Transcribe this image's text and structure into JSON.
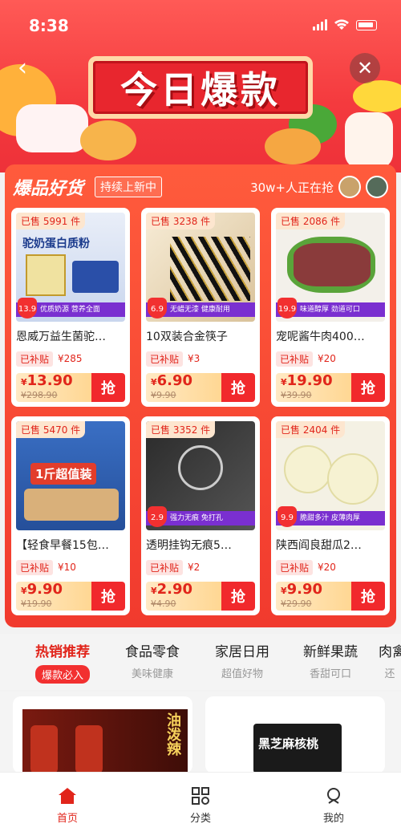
{
  "status": {
    "time": "8:38"
  },
  "banner": {
    "title": "今日爆款"
  },
  "section": {
    "title": "爆品好货",
    "tag": "持续上新中",
    "grabbing": "30w+人正在抢"
  },
  "products": [
    {
      "sold": "已售 5991 件",
      "img_text": "驼奶蛋白质粉",
      "ribbon": "优质奶源 营养全面",
      "tag_price": "13.9",
      "name": "恩威万益生菌驼…",
      "subsidy_label": "已补贴",
      "subsidy": "¥285",
      "price": "13.90",
      "old_price": "¥298.90",
      "grab": "抢"
    },
    {
      "sold": "已售 3238 件",
      "img_text": "",
      "ribbon": "无蜡无漆 健康耐用",
      "tag_price": "6.9",
      "name": "10双装合金筷子",
      "subsidy_label": "已补贴",
      "subsidy": "¥3",
      "price": "6.90",
      "old_price": "¥9.90",
      "grab": "抢"
    },
    {
      "sold": "已售 2086 件",
      "img_text": "",
      "ribbon": "味道醇厚 劲道可口",
      "tag_price": "19.9",
      "name": "宠呢酱牛肉400…",
      "subsidy_label": "已补贴",
      "subsidy": "¥20",
      "price": "19.90",
      "old_price": "¥39.90",
      "grab": "抢"
    },
    {
      "sold": "已售 5470 件",
      "img_text": "1斤超值装",
      "ribbon": "",
      "tag_price": "",
      "name": "【轻食早餐15包…",
      "subsidy_label": "已补贴",
      "subsidy": "¥10",
      "price": "9.90",
      "old_price": "¥19.90",
      "grab": "抢"
    },
    {
      "sold": "已售 3352 件",
      "img_text": "",
      "ribbon": "强力无痕 免打孔",
      "tag_price": "2.9",
      "name": "透明挂钩无痕5…",
      "subsidy_label": "已补贴",
      "subsidy": "¥2",
      "price": "2.90",
      "old_price": "¥4.90",
      "grab": "抢"
    },
    {
      "sold": "已售 2404 件",
      "img_text": "",
      "ribbon": "脆甜多汁 皮薄肉厚",
      "tag_price": "9.9",
      "name": "陕西阎良甜瓜2…",
      "subsidy_label": "已补贴",
      "subsidy": "¥20",
      "price": "9.90",
      "old_price": "¥29.90",
      "grab": "抢"
    }
  ],
  "tabs": [
    {
      "title": "热销推荐",
      "sub": "爆款必入"
    },
    {
      "title": "食品零食",
      "sub": "美味健康"
    },
    {
      "title": "家居日用",
      "sub": "超值好物"
    },
    {
      "title": "新鲜果蔬",
      "sub": "香甜可口"
    },
    {
      "title": "肉禽",
      "sub": "还"
    }
  ],
  "feed": {
    "left_text": "油泼辣",
    "right_text": "黑芝麻核桃"
  },
  "nav": {
    "home": "首页",
    "category": "分类",
    "mine": "我的"
  },
  "colors": {
    "accent": "#e1251b",
    "header": "#f43a3e"
  }
}
